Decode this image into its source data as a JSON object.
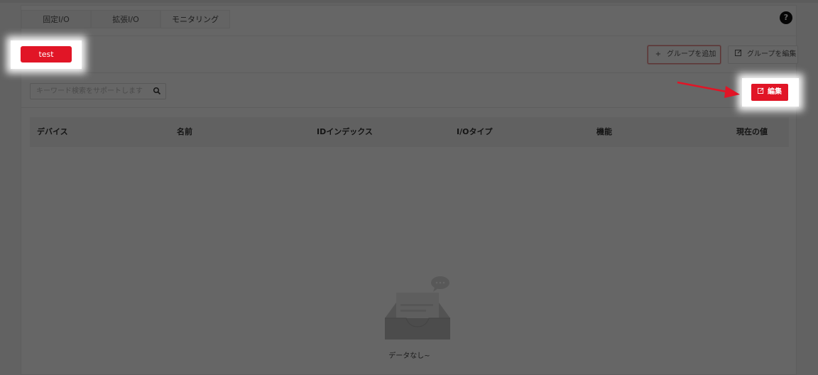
{
  "tabs": [
    {
      "label": "固定I/O",
      "active": false
    },
    {
      "label": "拡張I/O",
      "active": false
    },
    {
      "label": "モニタリング",
      "active": true
    }
  ],
  "help_icon": "?",
  "group_chip": {
    "label": "test"
  },
  "toolbar": {
    "add_group": {
      "icon": "+",
      "label": "グループを追加"
    },
    "edit_group": {
      "label": "グループを編集"
    }
  },
  "search": {
    "placeholder": "キーワード検索をサポートします"
  },
  "edit_button": {
    "label": "編集"
  },
  "table": {
    "columns": [
      "デバイス",
      "名前",
      "IDインデックス",
      "I/Oタイプ",
      "機能",
      "現在の値"
    ],
    "rows": []
  },
  "empty": {
    "text": "データなし~"
  },
  "colors": {
    "accent": "#e11526",
    "arrow": "#e11526"
  }
}
